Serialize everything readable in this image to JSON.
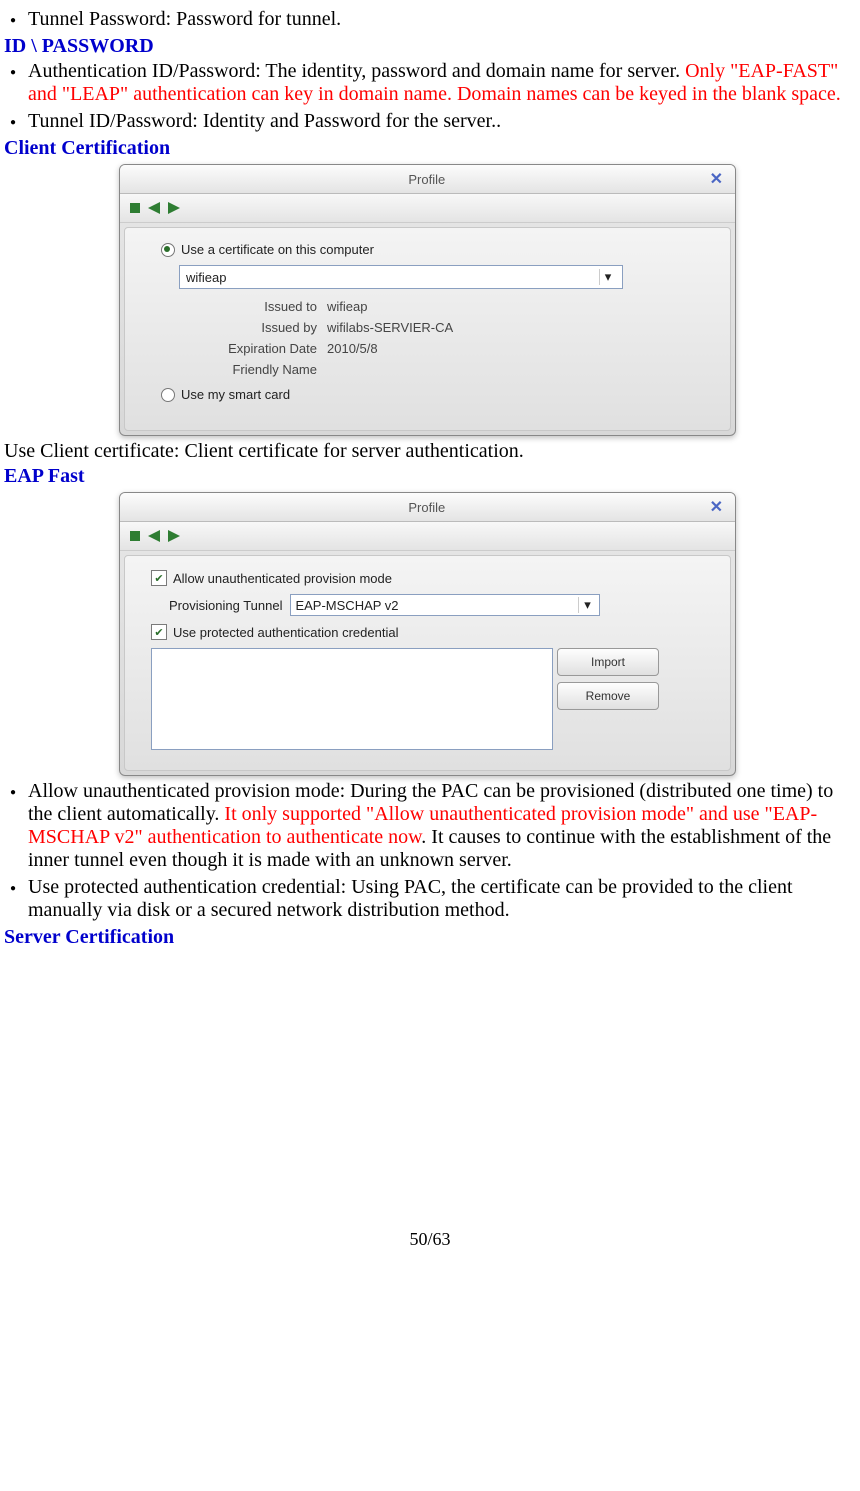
{
  "items": {
    "tunnel_pw": "Tunnel Password: Password for tunnel.",
    "auth_id_black": "Authentication ID/Password: The identity, password and domain name for server. ",
    "auth_id_red": "Only \"EAP-FAST\" and \"LEAP\" authentication can key in domain name. Domain names can be keyed in the blank space.",
    "tunnel_id": "Tunnel ID/Password: Identity and Password for the server..",
    "use_client_cert": "Use Client certificate:   Client certificate for server authentication.",
    "allow_black1": "Allow unauthenticated provision mode: During the PAC can be provisioned (distributed one time) to the client automatically. ",
    "allow_red": "It only supported \"Allow unauthenticated provision mode\" and use \"EAP-MSCHAP v2\" authentication to authenticate now",
    "allow_black2": ". It causes to continue with the establishment of the inner tunnel even though it is made with an unknown server.",
    "use_protected": "Use protected authentication credential: Using PAC, the certificate can be provided to the client manually via disk or a secured network distribution method."
  },
  "headings": {
    "id_password": "ID \\ PASSWORD",
    "client_cert": "Client Certification",
    "eap_fast": "EAP Fast",
    "server_cert": "Server Certification"
  },
  "dialog1": {
    "title": "Profile",
    "radio1": "Use a certificate on this computer",
    "select_value": "wifieap",
    "issued_to_label": "Issued to",
    "issued_to_value": "wifieap",
    "issued_by_label": "Issued by",
    "issued_by_value": "wifilabs-SERVIER-CA",
    "expiration_label": "Expiration Date",
    "expiration_value": "2010/5/8",
    "friendly_label": "Friendly Name",
    "friendly_value": "",
    "radio2": "Use my smart card"
  },
  "dialog2": {
    "title": "Profile",
    "check1": "Allow unauthenticated provision mode",
    "prov_label": "Provisioning Tunnel",
    "prov_value": "EAP-MSCHAP v2",
    "check2": "Use protected authentication credential",
    "import_btn": "Import",
    "remove_btn": "Remove"
  },
  "page_number": "50/63"
}
